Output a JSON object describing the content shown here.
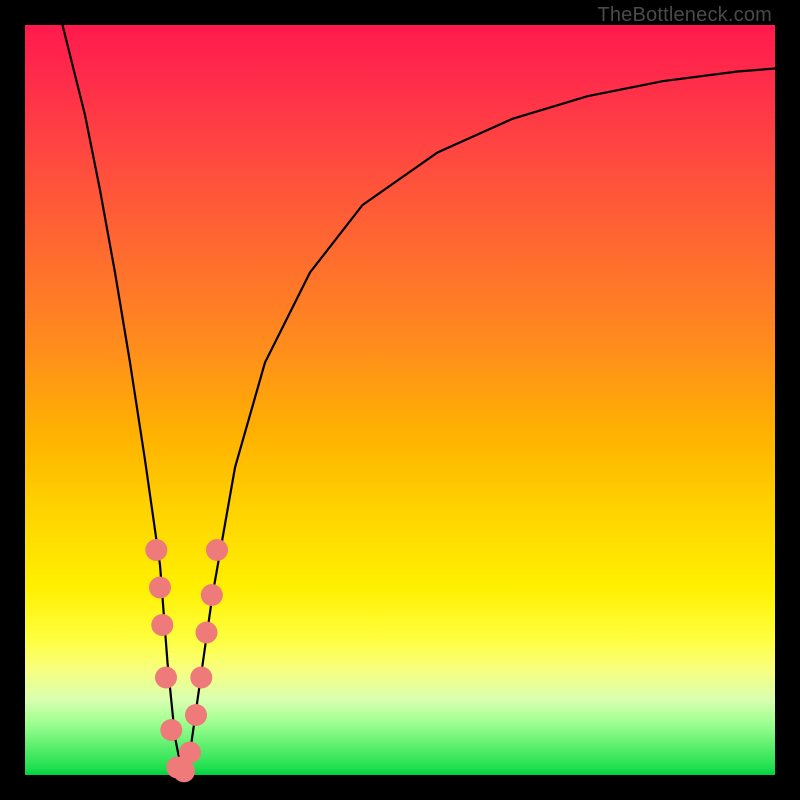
{
  "watermark": "TheBottleneck.com",
  "chart_data": {
    "type": "line",
    "title": "",
    "xlabel": "",
    "ylabel": "",
    "xlim": [
      0,
      100
    ],
    "ylim": [
      0,
      100
    ],
    "series": [
      {
        "name": "bottleneck-curve",
        "x": [
          5,
          8,
          10,
          12,
          14,
          16,
          18,
          19,
          20,
          21,
          22,
          23,
          25,
          28,
          32,
          38,
          45,
          55,
          65,
          75,
          85,
          95,
          100
        ],
        "values": [
          100,
          88,
          78,
          67,
          55,
          42,
          28,
          15,
          5,
          0,
          3,
          10,
          24,
          41,
          55,
          67,
          76,
          83,
          87.5,
          90.5,
          92.5,
          93.8,
          94.2
        ]
      }
    ],
    "markers": {
      "name": "highlighted-points",
      "color": "#ef7a7a",
      "points": [
        {
          "x": 17.5,
          "y": 30
        },
        {
          "x": 18.0,
          "y": 25
        },
        {
          "x": 18.3,
          "y": 20
        },
        {
          "x": 18.8,
          "y": 13
        },
        {
          "x": 19.5,
          "y": 6
        },
        {
          "x": 20.3,
          "y": 1
        },
        {
          "x": 21.2,
          "y": 0.5
        },
        {
          "x": 22.0,
          "y": 3
        },
        {
          "x": 22.8,
          "y": 8
        },
        {
          "x": 23.5,
          "y": 13
        },
        {
          "x": 24.2,
          "y": 19
        },
        {
          "x": 24.9,
          "y": 24
        },
        {
          "x": 25.6,
          "y": 30
        }
      ]
    },
    "gradient_bands": [
      {
        "pos": 0,
        "color": "#ff1a4d"
      },
      {
        "pos": 30,
        "color": "#ff6a30"
      },
      {
        "pos": 55,
        "color": "#ffb300"
      },
      {
        "pos": 80,
        "color": "#fff000"
      },
      {
        "pos": 95,
        "color": "#60f070"
      },
      {
        "pos": 100,
        "color": "#00d040"
      }
    ]
  }
}
